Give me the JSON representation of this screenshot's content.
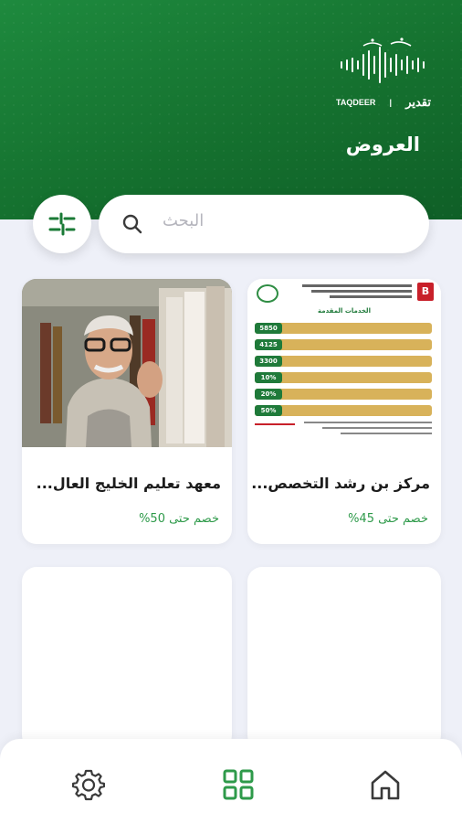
{
  "header": {
    "title": "العروض",
    "logo_latin": "TAQDEER",
    "logo_arabic": "تقدير"
  },
  "search": {
    "placeholder": "البحث"
  },
  "offers": [
    {
      "name": "مركز بن رشد التخصص...",
      "discount": "خصم حتى 45%",
      "flyer": {
        "heading": "الخدمات المقدمة",
        "rows": [
          "5850",
          "4125",
          "3300",
          "10%",
          "20%",
          "50%"
        ]
      }
    },
    {
      "name": "معهد تعليم الخليج العال...",
      "discount": "خصم حتى 50%"
    }
  ],
  "colors": {
    "header_green": "#15712f",
    "accent_green": "#2e9a4a",
    "background": "#eef0f8"
  },
  "nav": [
    {
      "icon": "home-icon"
    },
    {
      "icon": "grid-icon"
    },
    {
      "icon": "settings-icon"
    }
  ]
}
